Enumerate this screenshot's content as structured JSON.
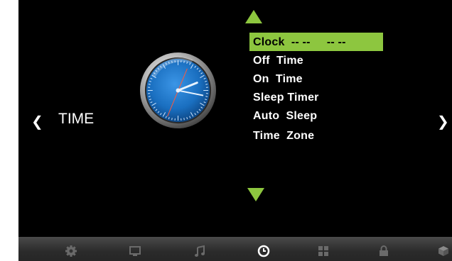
{
  "section": {
    "title": "TIME",
    "prev_icon": "chevron-left-icon",
    "next_icon": "chevron-right-icon",
    "prev_glyph": "❮",
    "next_glyph": "❯"
  },
  "menu": {
    "items": [
      {
        "label": "Clock  -- --     -- --",
        "selected": true
      },
      {
        "label": "Off  Time"
      },
      {
        "label": "On  Time"
      },
      {
        "label": "Sleep Timer"
      },
      {
        "label": "Auto  Sleep"
      },
      {
        "label": "Time  Zone"
      }
    ],
    "scroll_up_icon": "triangle-up-icon",
    "scroll_down_icon": "triangle-down-icon"
  },
  "tabs": [
    {
      "name": "settings",
      "icon": "gear-icon"
    },
    {
      "name": "picture",
      "icon": "monitor-icon"
    },
    {
      "name": "sound",
      "icon": "music-note-icon"
    },
    {
      "name": "time",
      "icon": "clock-icon",
      "active": true
    },
    {
      "name": "apps",
      "icon": "grid-icon"
    },
    {
      "name": "lock",
      "icon": "lock-icon"
    },
    {
      "name": "setup",
      "icon": "cube-icon"
    }
  ],
  "colors": {
    "accent": "#8dc63f",
    "background": "#000000",
    "tab_inactive": "#6a6a6a",
    "tab_active": "#ffffff",
    "clock_face": "#1a6fc0"
  }
}
